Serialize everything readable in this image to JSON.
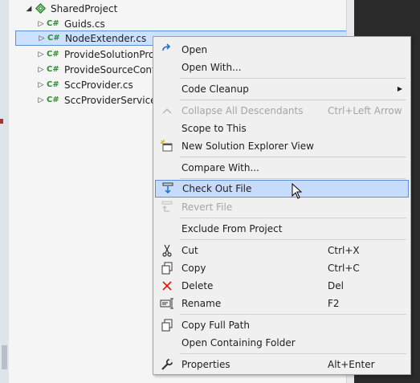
{
  "tree": {
    "project": "SharedProject",
    "files": [
      {
        "label": "Guids.cs",
        "lang": "C#"
      },
      {
        "label": "NodeExtender.cs",
        "lang": "C#"
      },
      {
        "label": "ProvideSolutionPro",
        "lang": "C#"
      },
      {
        "label": "ProvideSourceCont",
        "lang": "C#"
      },
      {
        "label": "SccProvider.cs",
        "lang": "C#"
      },
      {
        "label": "SccProviderService",
        "lang": "C#"
      }
    ]
  },
  "menu": {
    "open": "Open",
    "open_with": "Open With...",
    "code_cleanup": "Code Cleanup",
    "collapse_all": "Collapse All Descendants",
    "collapse_all_shortcut": "Ctrl+Left Arrow",
    "scope_to_this": "Scope to This",
    "new_solution_explorer_view": "New Solution Explorer View",
    "compare_with": "Compare With...",
    "check_out_file": "Check Out File",
    "revert_file": "Revert File",
    "exclude_from_project": "Exclude From Project",
    "cut": "Cut",
    "cut_shortcut": "Ctrl+X",
    "copy": "Copy",
    "copy_shortcut": "Ctrl+C",
    "delete": "Delete",
    "delete_shortcut": "Del",
    "rename": "Rename",
    "rename_shortcut": "F2",
    "copy_full_path": "Copy Full Path",
    "open_containing_folder": "Open Containing Folder",
    "properties": "Properties",
    "properties_shortcut": "Alt+Enter"
  },
  "icons": {
    "open": "open-arrow-icon",
    "new_view": "new-solution-explorer-view-icon",
    "check_out": "check-out-icon",
    "revert": "revert-icon",
    "cut": "scissors-icon",
    "copy": "copy-icon",
    "delete": "delete-x-icon",
    "rename": "rename-icon",
    "copy_path": "copy-full-path-icon",
    "properties": "wrench-icon"
  },
  "colors": {
    "selection": "#cce1ff",
    "highlight": "#c6dcfa",
    "accent": "#5e8fd9",
    "csharp": "#2e8b2e",
    "delete": "#e51400"
  }
}
